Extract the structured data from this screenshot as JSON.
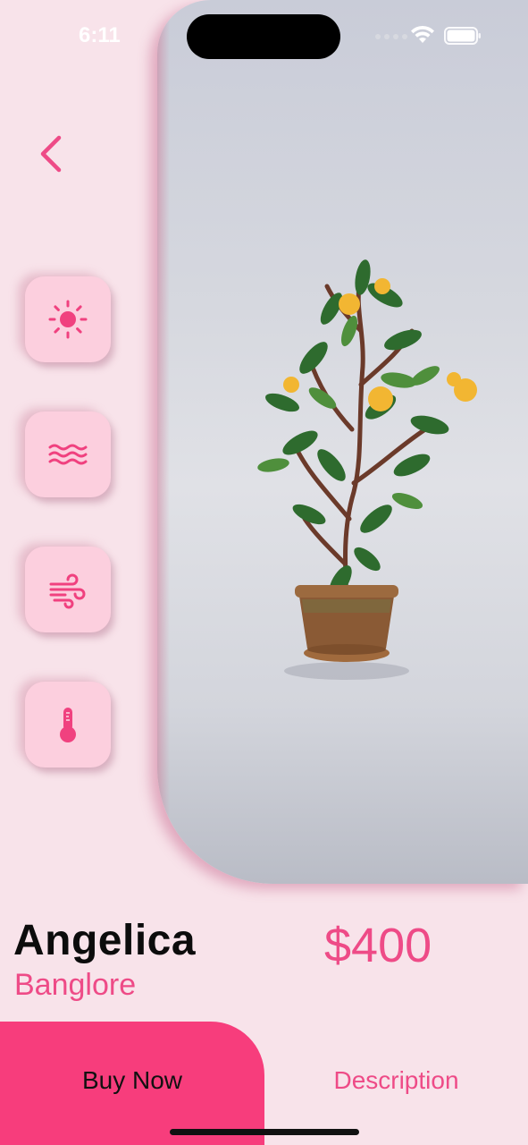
{
  "status_bar": {
    "time": "6:11"
  },
  "icons": {
    "back": "chevron-left-icon",
    "features": [
      "sun-icon",
      "water-waves-icon",
      "wind-icon",
      "thermometer-icon"
    ],
    "wifi": "wifi-icon",
    "battery": "battery-icon"
  },
  "product": {
    "name": "Angelica",
    "location": "Banglore",
    "price": "$400"
  },
  "actions": {
    "buy_now_label": "Buy Now",
    "description_label": "Description"
  },
  "colors": {
    "accent": "#f73d7c",
    "accent_text": "#ee4b87",
    "background": "#f8e3ea",
    "feature_button_bg": "#fccfde"
  }
}
